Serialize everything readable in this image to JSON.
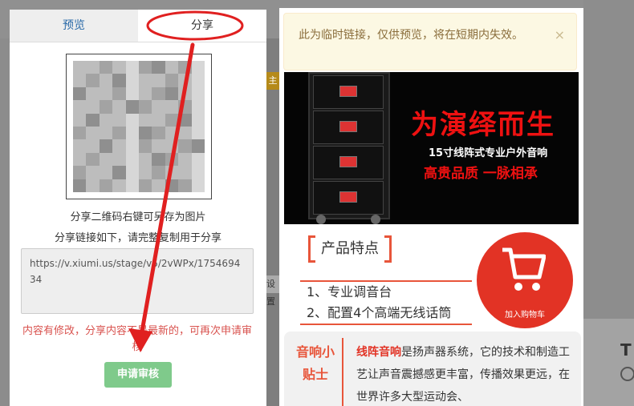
{
  "tabs": {
    "preview": "预览",
    "share": "分享"
  },
  "share": {
    "qr_hint": "分享二维码右键可另存为图片",
    "link_hint": "分享链接如下，请完整复制用于分享",
    "link_value": "https://v.xiumi.us/stage/v5/2vWPx/175469434",
    "warning": "内容有修改，分享内容不是最新的，可再次申请审核",
    "submit_label": "申请审核"
  },
  "preview": {
    "alert_text": "此为临时链接，仅供预览，将在短期内失效。",
    "close_glyph": "×",
    "banner": {
      "title": "为演绎而生",
      "subtitle": "15寸线阵式专业户外音响",
      "tagline": "高贵品质 一脉相承"
    },
    "features_title": "产品特点",
    "features": [
      "1、专业调音台",
      "2、配置4个高端无线话筒"
    ],
    "cart_label": "加入购物车",
    "tip_label": "音响小贴士",
    "tip_keyword": "线阵音响",
    "tip_body": "是扬声器系统，它的技术和制造工艺让声音震撼感更丰富，传播效果更远，在世界许多大型运动会、"
  },
  "background": {
    "tag_main": "主",
    "tag_settings": "设置",
    "letter": "T"
  },
  "colors": {
    "accent": "#e8553a",
    "cart": "#e23325",
    "button": "#7fca8b",
    "link_blue": "#2a6aa8",
    "annotation": "#e02020"
  }
}
